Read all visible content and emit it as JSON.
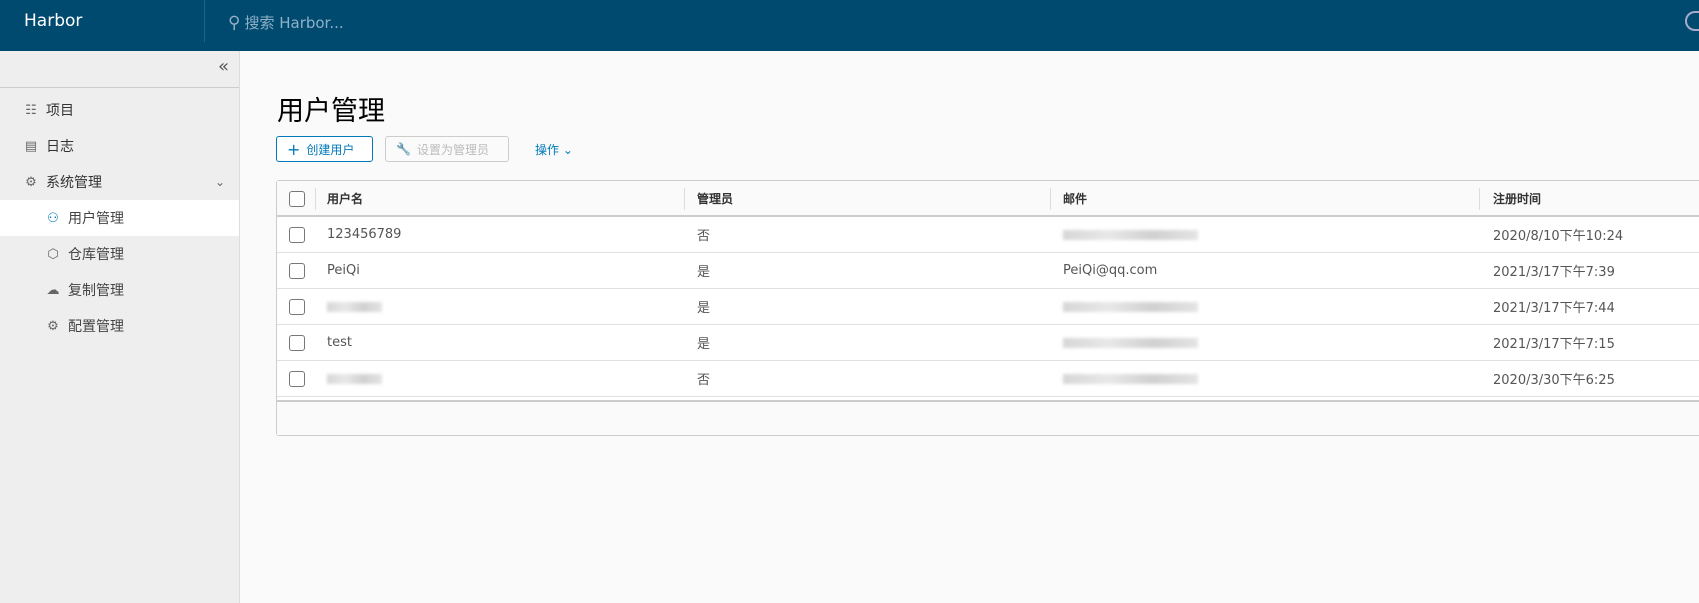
{
  "header": {
    "brand": "Harbor",
    "search_placeholder": "搜索 Harbor..."
  },
  "sidebar": {
    "items": [
      {
        "label": "项目",
        "icon": "projects-icon"
      },
      {
        "label": "日志",
        "icon": "logs-icon"
      },
      {
        "label": "系统管理",
        "icon": "admin-icon"
      },
      {
        "label": "用户管理",
        "icon": "users-icon",
        "active": true
      },
      {
        "label": "仓库管理",
        "icon": "registry-icon"
      },
      {
        "label": "复制管理",
        "icon": "replication-icon"
      },
      {
        "label": "配置管理",
        "icon": "gear-icon"
      }
    ]
  },
  "main": {
    "title": "用户管理",
    "create_user": "创建用户",
    "set_admin": "设置为管理员",
    "actions": "操作",
    "columns": [
      "用户名",
      "管理员",
      "邮件",
      "注册时间"
    ],
    "rows": [
      {
        "username": "123456789",
        "admin": "否",
        "email": "",
        "registered": "2020/8/10下午10:24"
      },
      {
        "username": "PeiQi",
        "admin": "是",
        "email": "PeiQi@qq.com",
        "registered": "2021/3/17下午7:39"
      },
      {
        "username": "",
        "admin": "是",
        "email": "",
        "registered": "2021/3/17下午7:44"
      },
      {
        "username": "test",
        "admin": "是",
        "email": "",
        "registered": "2021/3/17下午7:15"
      },
      {
        "username": "",
        "admin": "否",
        "email": "",
        "registered": "2020/3/30下午6:25"
      }
    ]
  },
  "colors": {
    "header": "#004a70",
    "accent": "#0079b8"
  }
}
